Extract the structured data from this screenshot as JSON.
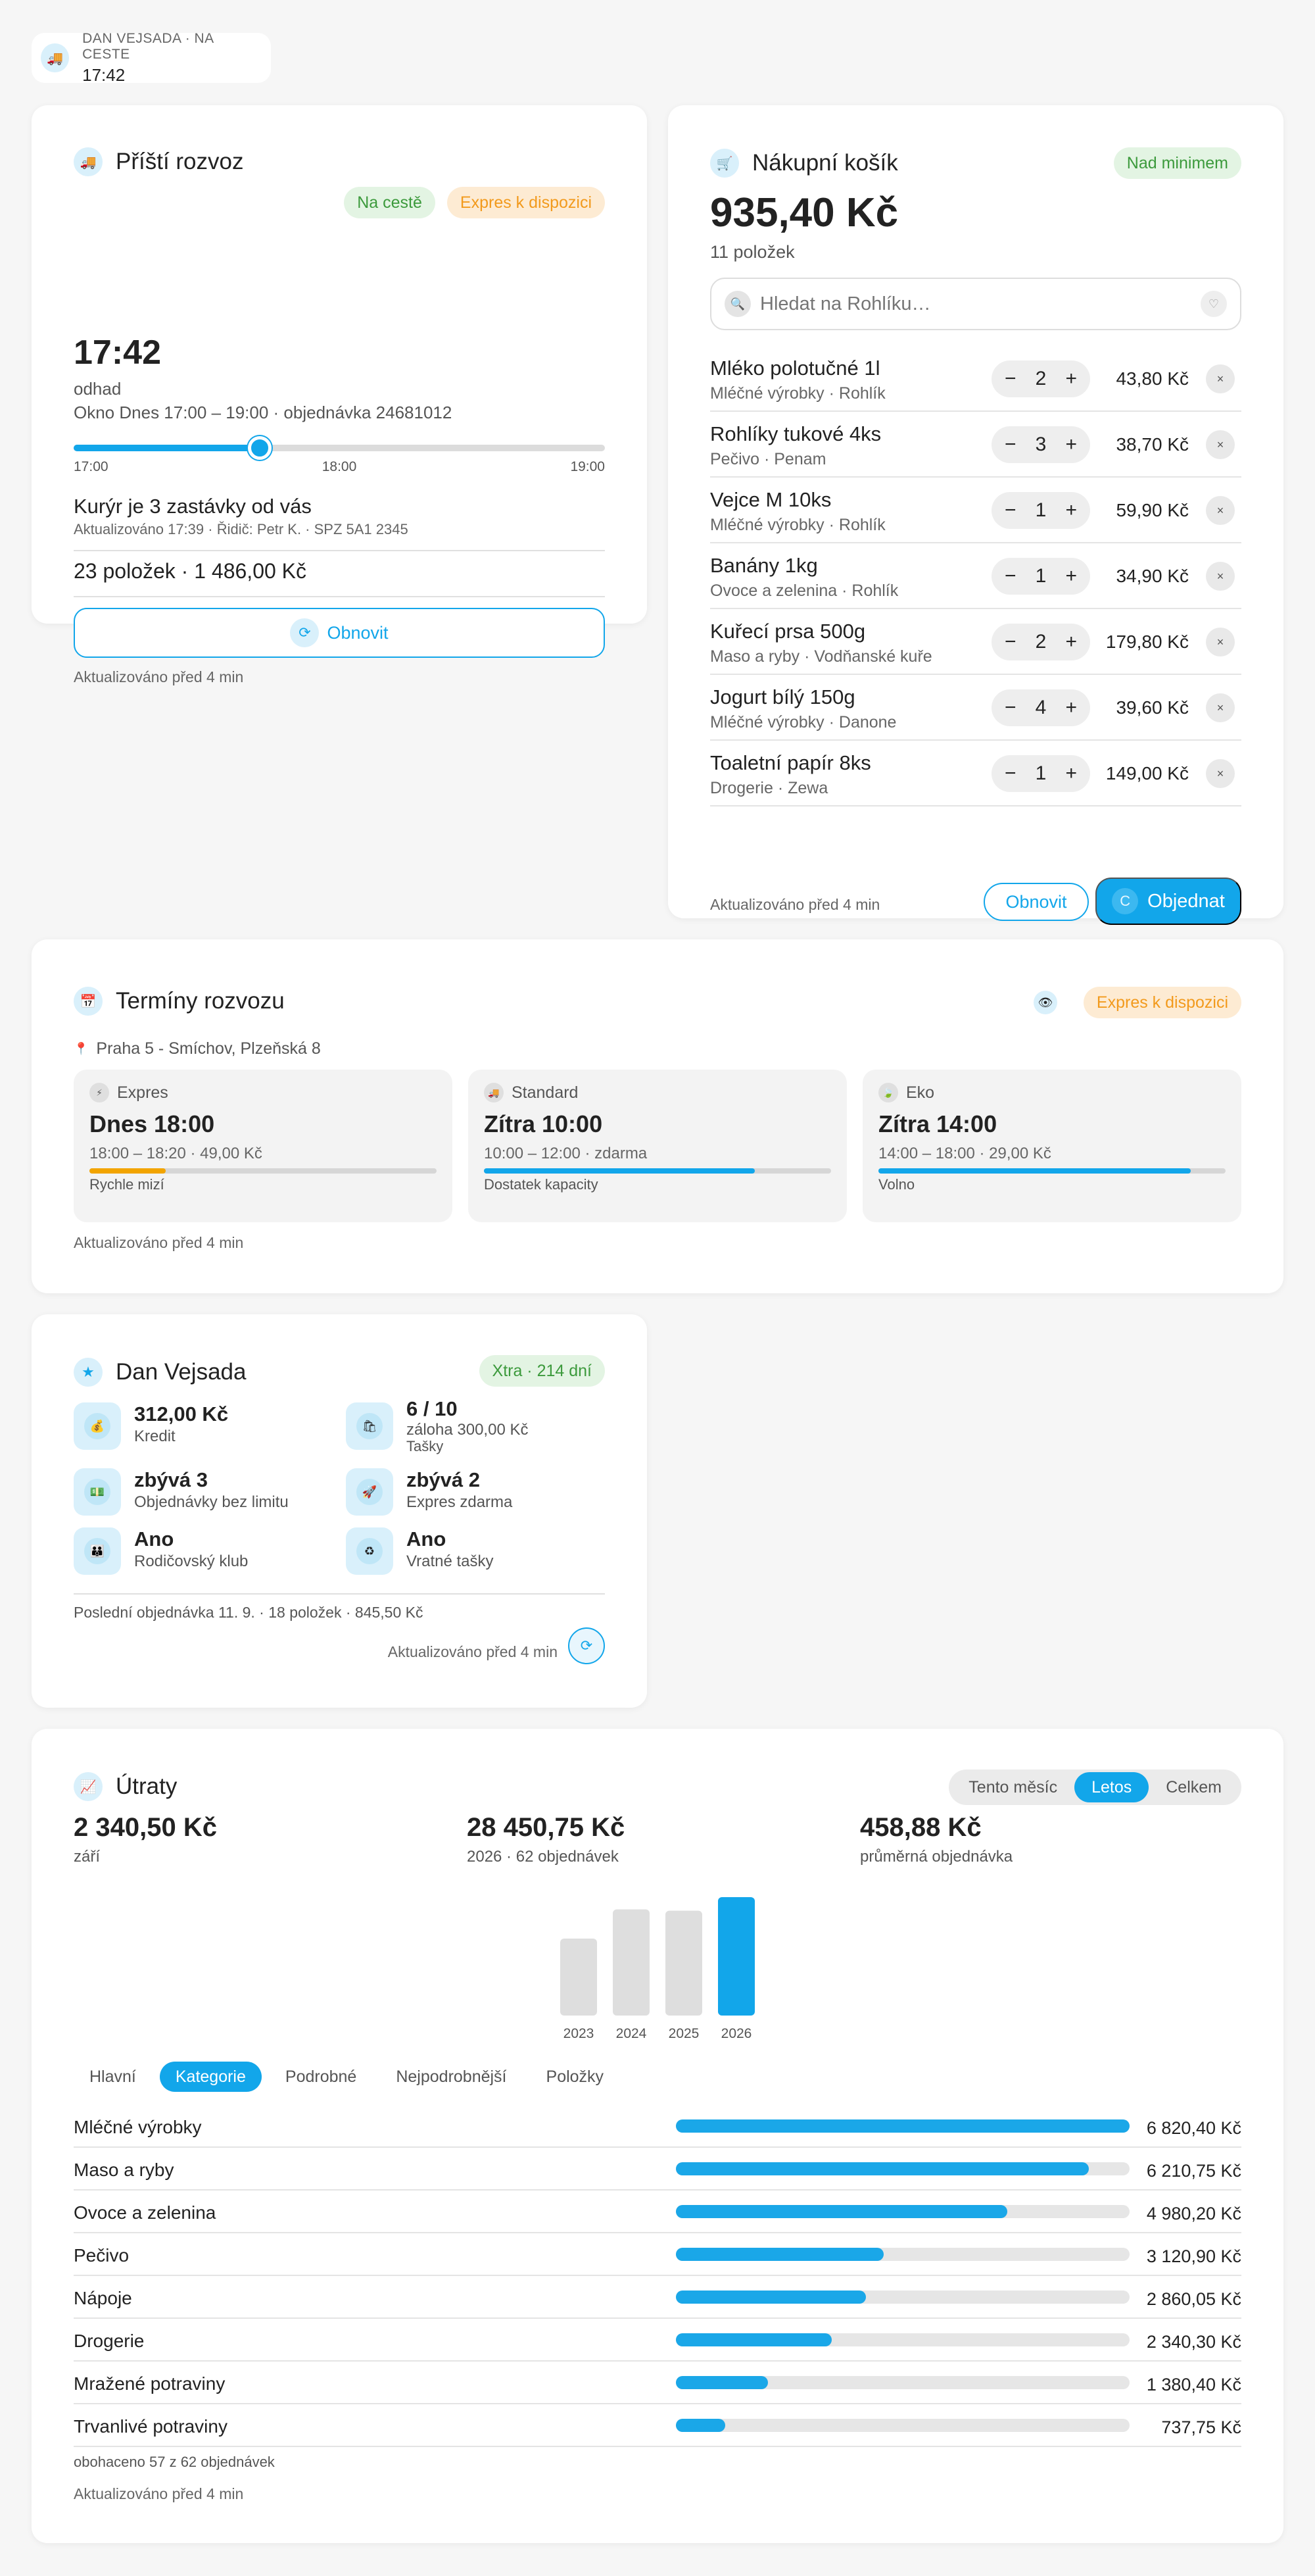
{
  "status": {
    "label": "DAN VEJSADA · NA CESTE",
    "time": "17:42",
    "icon": "truck-icon"
  },
  "delivery": {
    "title": "Příští rozvoz",
    "badge_status": "Na cestě",
    "badge_express": "Expres k dispozici",
    "eta": "17:42",
    "eta_label": "odhad",
    "window": "Okno Dnes 17:00 – 19:00 · objednávka 24681012",
    "progress": 0.35,
    "axis": [
      "17:00",
      "18:00",
      "19:00"
    ],
    "courier": "Kurýr je 3 zastávky od vás",
    "courier_sub": "Aktualizováno 17:39 · Řidič: Petr K. · SPZ 5A1 2345",
    "summary": "23 položek · 1 486,00 Kč",
    "refresh_label": "Obnovit",
    "updated": "Aktualizováno před 4 min"
  },
  "cart": {
    "title": "Nákupní košík",
    "badge": "Nad minimem",
    "total": "935,40 Kč",
    "count": "11 položek",
    "search_placeholder": "Hledat na Rohlíku…",
    "items": [
      {
        "name": "Mléko polotučné 1l",
        "sub": "Mléčné výrobky · Rohlík",
        "qty": "2",
        "price": "43,80 Kč"
      },
      {
        "name": "Rohlíky tukové 4ks",
        "sub": "Pečivo · Penam",
        "qty": "3",
        "price": "38,70 Kč"
      },
      {
        "name": "Vejce M 10ks",
        "sub": "Mléčné výrobky · Rohlík",
        "qty": "1",
        "price": "59,90 Kč"
      },
      {
        "name": "Banány 1kg",
        "sub": "Ovoce a zelenina · Rohlík",
        "qty": "1",
        "price": "34,90 Kč"
      },
      {
        "name": "Kuřecí prsa 500g",
        "sub": "Maso a ryby · Vodňanské kuře",
        "qty": "2",
        "price": "179,80 Kč"
      },
      {
        "name": "Jogurt bílý 150g",
        "sub": "Mléčné výrobky · Danone",
        "qty": "4",
        "price": "39,60 Kč"
      },
      {
        "name": "Toaletní papír 8ks",
        "sub": "Drogerie · Zewa",
        "qty": "1",
        "price": "149,00 Kč"
      }
    ],
    "minus": "−",
    "plus": "+",
    "remove": "×",
    "updated": "Aktualizováno před 4 min",
    "refresh_label": "Obnovit",
    "order_label": "Objednat",
    "order_icon_letter": "C"
  },
  "slots": {
    "title": "Termíny rozvozu",
    "badge": "Expres k dispozici",
    "address": "Praha 5 - Smíchov, Plzeňská 8",
    "items": [
      {
        "name": "Expres",
        "time": "Dnes 18:00",
        "detail": "18:00 – 18:20 · 49,00 Kč",
        "fill": 0.22,
        "color": "#f2a400",
        "status": "Rychle mizí",
        "icon": "lightning-icon"
      },
      {
        "name": "Standard",
        "time": "Zítra 10:00",
        "detail": "10:00 – 12:00 · zdarma",
        "fill": 0.78,
        "color": "#12a6ea",
        "status": "Dostatek kapacity",
        "icon": "truck-icon"
      },
      {
        "name": "Eko",
        "time": "Zítra 14:00",
        "detail": "14:00 – 18:00 · 29,00 Kč",
        "fill": 0.9,
        "color": "#12a6ea",
        "status": "Volno",
        "icon": "leaf-icon"
      }
    ],
    "updated": "Aktualizováno před 4 min"
  },
  "account": {
    "name": "Dan Vejsada",
    "badge": "Xtra · 214 dní",
    "perks": [
      {
        "value": "312,00 Kč",
        "label": "Kredit",
        "label2": "",
        "icon": "money-bag-icon"
      },
      {
        "value": "6 / 10",
        "label": "záloha 300,00 Kč",
        "label2": "Tašky",
        "icon": "bag-icon"
      },
      {
        "value": "zbývá 3",
        "label": "Objednávky bez limitu",
        "label2": "",
        "icon": "cash-icon"
      },
      {
        "value": "zbývá 2",
        "label": "Expres zdarma",
        "label2": "",
        "icon": "rocket-icon"
      },
      {
        "value": "Ano",
        "label": "Rodičovský klub",
        "label2": "",
        "icon": "family-icon"
      },
      {
        "value": "Ano",
        "label": "Vratné tašky",
        "label2": "",
        "icon": "recycle-icon"
      }
    ],
    "last_order": "Poslední objednávka 11. 9. · 18 položek · 845,50 Kč",
    "updated": "Aktualizováno před 4 min"
  },
  "spending": {
    "title": "Útraty",
    "periods": [
      "Tento měsíc",
      "Letos",
      "Celkem"
    ],
    "active_period": 1,
    "stats": [
      {
        "value": "2 340,50 Kč",
        "label": "září"
      },
      {
        "value": "28 450,75 Kč",
        "label": "2026 · 62 objednávek"
      },
      {
        "value": "458,88 Kč",
        "label": "průměrná objednávka"
      }
    ],
    "tabs": [
      "Hlavní",
      "Kategorie",
      "Podrobné",
      "Nejpodrobnější",
      "Položky"
    ],
    "active_tab": 1,
    "categories": [
      {
        "name": "Mléčné výrobky",
        "value": "6 820,40 Kč",
        "amount": 6820.4
      },
      {
        "name": "Maso a ryby",
        "value": "6 210,75 Kč",
        "amount": 6210.75
      },
      {
        "name": "Ovoce a zelenina",
        "value": "4 980,20 Kč",
        "amount": 4980.2
      },
      {
        "name": "Pečivo",
        "value": "3 120,90 Kč",
        "amount": 3120.9
      },
      {
        "name": "Nápoje",
        "value": "2 860,05 Kč",
        "amount": 2860.05
      },
      {
        "name": "Drogerie",
        "value": "2 340,30 Kč",
        "amount": 2340.3
      },
      {
        "name": "Mražené potraviny",
        "value": "1 380,40 Kč",
        "amount": 1380.4
      },
      {
        "name": "Trvanlivé potraviny",
        "value": "737,75 Kč",
        "amount": 737.75
      }
    ],
    "enriched": "obohaceno 57 z 62 objednávek",
    "updated": "Aktualizováno před 4 min"
  },
  "chart_data": {
    "type": "bar",
    "categories": [
      "2023",
      "2024",
      "2025",
      "2026"
    ],
    "values": [
      18500,
      25500,
      25200,
      28450.75
    ],
    "highlight": "2026",
    "colors": {
      "default": "#dedede",
      "highlight": "#12a6ea"
    }
  }
}
